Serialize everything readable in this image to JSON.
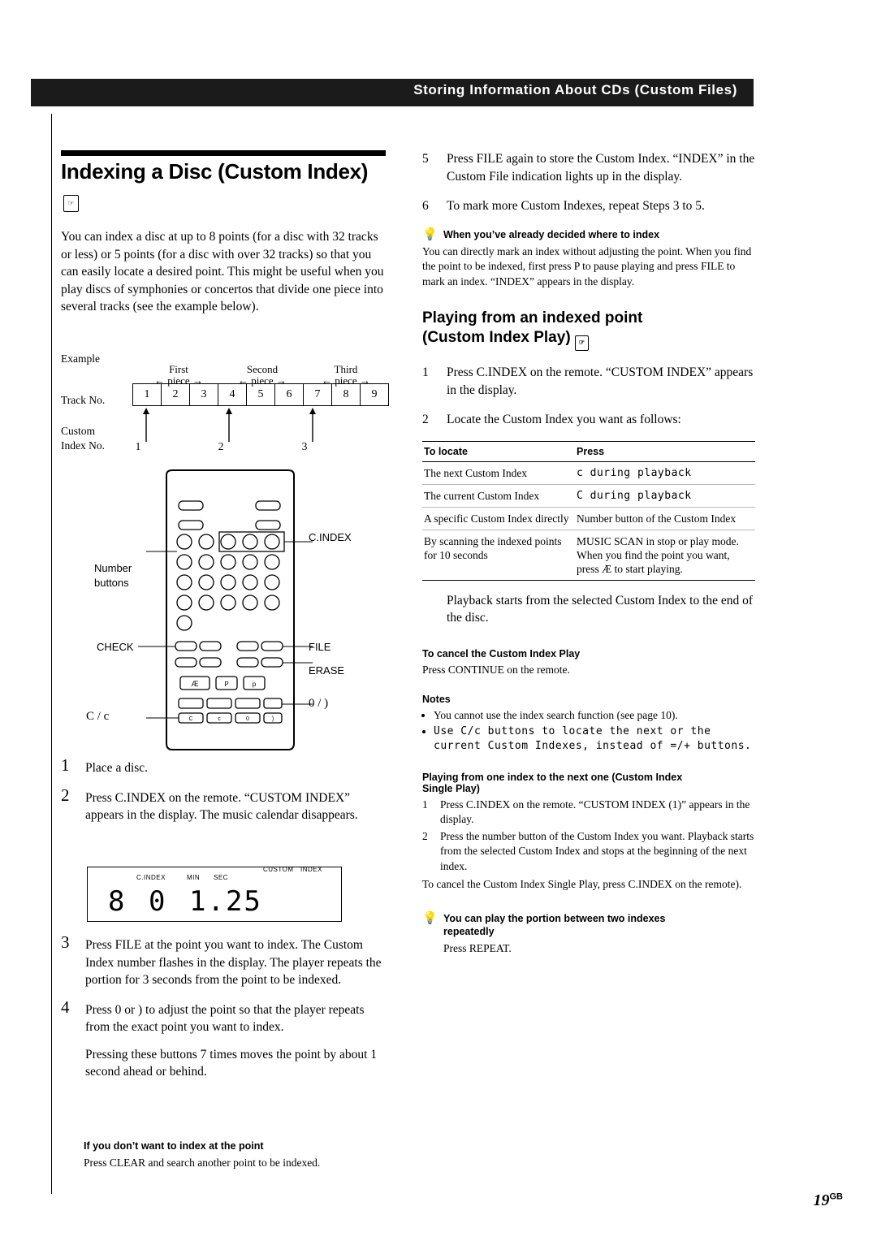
{
  "header": {
    "banner_title": "Storing Information About CDs (Custom Files)"
  },
  "page": {
    "number": "19",
    "region": "GB"
  },
  "left": {
    "title": "Indexing a Disc (Custom Index)",
    "intro": "You can index a disc at up to 8 points (for a disc with 32 tracks or less) or 5 points (for a disc with over 32 tracks) so that you can easily locate a desired point. This might be useful when you play discs of symphonies or concertos that divide one piece into several tracks (see the example below).",
    "example": {
      "label": "Example",
      "track_label": "Track No.",
      "custom_label_line1": "Custom",
      "custom_label_line2": "Index No.",
      "pieces": [
        {
          "name_line1": "First",
          "name_line2": "piece"
        },
        {
          "name_line1": "Second",
          "name_line2": "piece"
        },
        {
          "name_line1": "Third",
          "name_line2": "piece"
        }
      ],
      "tracks": [
        "1",
        "2",
        "3",
        "4",
        "5",
        "6",
        "7",
        "8",
        "9"
      ],
      "index_numbers": [
        "1",
        "2",
        "3"
      ]
    },
    "remote_callouts": {
      "c_index": "C.INDEX",
      "number_buttons_line1": "Number",
      "number_buttons_line2": "buttons",
      "check": "CHECK",
      "file": "FILE",
      "erase": "ERASE",
      "prev_next": "0  /  )",
      "scan": "C  /  c"
    },
    "steps": [
      {
        "n": "1",
        "text": "Place a disc."
      },
      {
        "n": "2",
        "text": "Press C.INDEX on the remote. “CUSTOM INDEX” appears in the display. The music calendar disappears."
      },
      {
        "n": "3",
        "text": "Press FILE at the point you want to index. The Custom Index number flashes in the display. The player repeats the portion for 3 seconds from the point to be indexed."
      },
      {
        "n": "4",
        "text": "Press 0 or ) to adjust the point so that the player repeats from the exact point you want to index.",
        "extra": "Pressing these buttons 7 times moves the point by about 1 second ahead or behind."
      }
    ],
    "display": {
      "c_index": "C.INDEX",
      "min": "MIN",
      "sec": "SEC",
      "custom": "CUSTOM",
      "index": "INDEX",
      "disc_digit": "8",
      "track_digit": "0",
      "time": "1.25"
    },
    "note_box": {
      "title": "If you don’t want to index at the point",
      "body": "Press CLEAR and search another point to be indexed."
    }
  },
  "right": {
    "steps": [
      {
        "n": "5",
        "text": "Press FILE again to store the Custom Index. “INDEX” in the Custom File indication lights up in the display."
      },
      {
        "n": "6",
        "text": "To mark more Custom Indexes, repeat Steps 3 to 5."
      }
    ],
    "tip1": {
      "title": "When you’ve already decided where to index",
      "body": "You can directly mark an index without adjusting the point. When you find the point to be indexed, first press P to pause playing and press FILE to mark an index. “INDEX” appears in the display."
    },
    "section2": {
      "title_line1": "Playing from an indexed point",
      "title_line2": "(Custom Index Play)",
      "steps": [
        {
          "n": "1",
          "text": "Press C.INDEX on the remote. “CUSTOM INDEX” appears in the display."
        },
        {
          "n": "2",
          "text": "Locate the Custom Index you want as follows:"
        }
      ],
      "table": {
        "headers": [
          "To locate",
          "Press"
        ],
        "rows": [
          {
            "locate": "The next Custom Index",
            "press": "c  during  playback",
            "mono": true
          },
          {
            "locate": "The current Custom Index",
            "press": "C  during  playback",
            "mono": true
          },
          {
            "locate": "A specific Custom Index directly",
            "press": "Number button of the Custom Index",
            "mono": false
          },
          {
            "locate": "By scanning the indexed points for 10 seconds",
            "press": "MUSIC SCAN in stop or play mode. When you find the point you want, press Æ to start playing.",
            "mono": false
          }
        ]
      },
      "after_table": "Playback starts from the selected Custom Index to the end of the disc."
    },
    "cancel": {
      "title": "To cancel the Custom Index Play",
      "body": "Press CONTINUE on the remote."
    },
    "notes": {
      "title": "Notes",
      "items": [
        "You cannot use the index search function (see page 10).",
        "Use C/c buttons to locate the next or the current Custom Indexes, instead of =/+ buttons."
      ]
    },
    "single_play": {
      "title_line1": "Playing from one index to the next one (Custom Index",
      "title_line2": "Single Play)",
      "steps": [
        {
          "n": "1",
          "text": "Press C.INDEX on the remote. “CUSTOM INDEX (1)” appears in the display."
        },
        {
          "n": "2",
          "text": "Press the number button of the Custom Index you want. Playback starts from the selected Custom Index and stops at the beginning of the next index."
        }
      ],
      "footer": "To cancel the Custom Index Single Play, press C.INDEX on the remote)."
    },
    "tip2": {
      "title_line1": "You can play the portion between two indexes",
      "title_line2": "repeatedly",
      "body": "Press REPEAT."
    }
  }
}
